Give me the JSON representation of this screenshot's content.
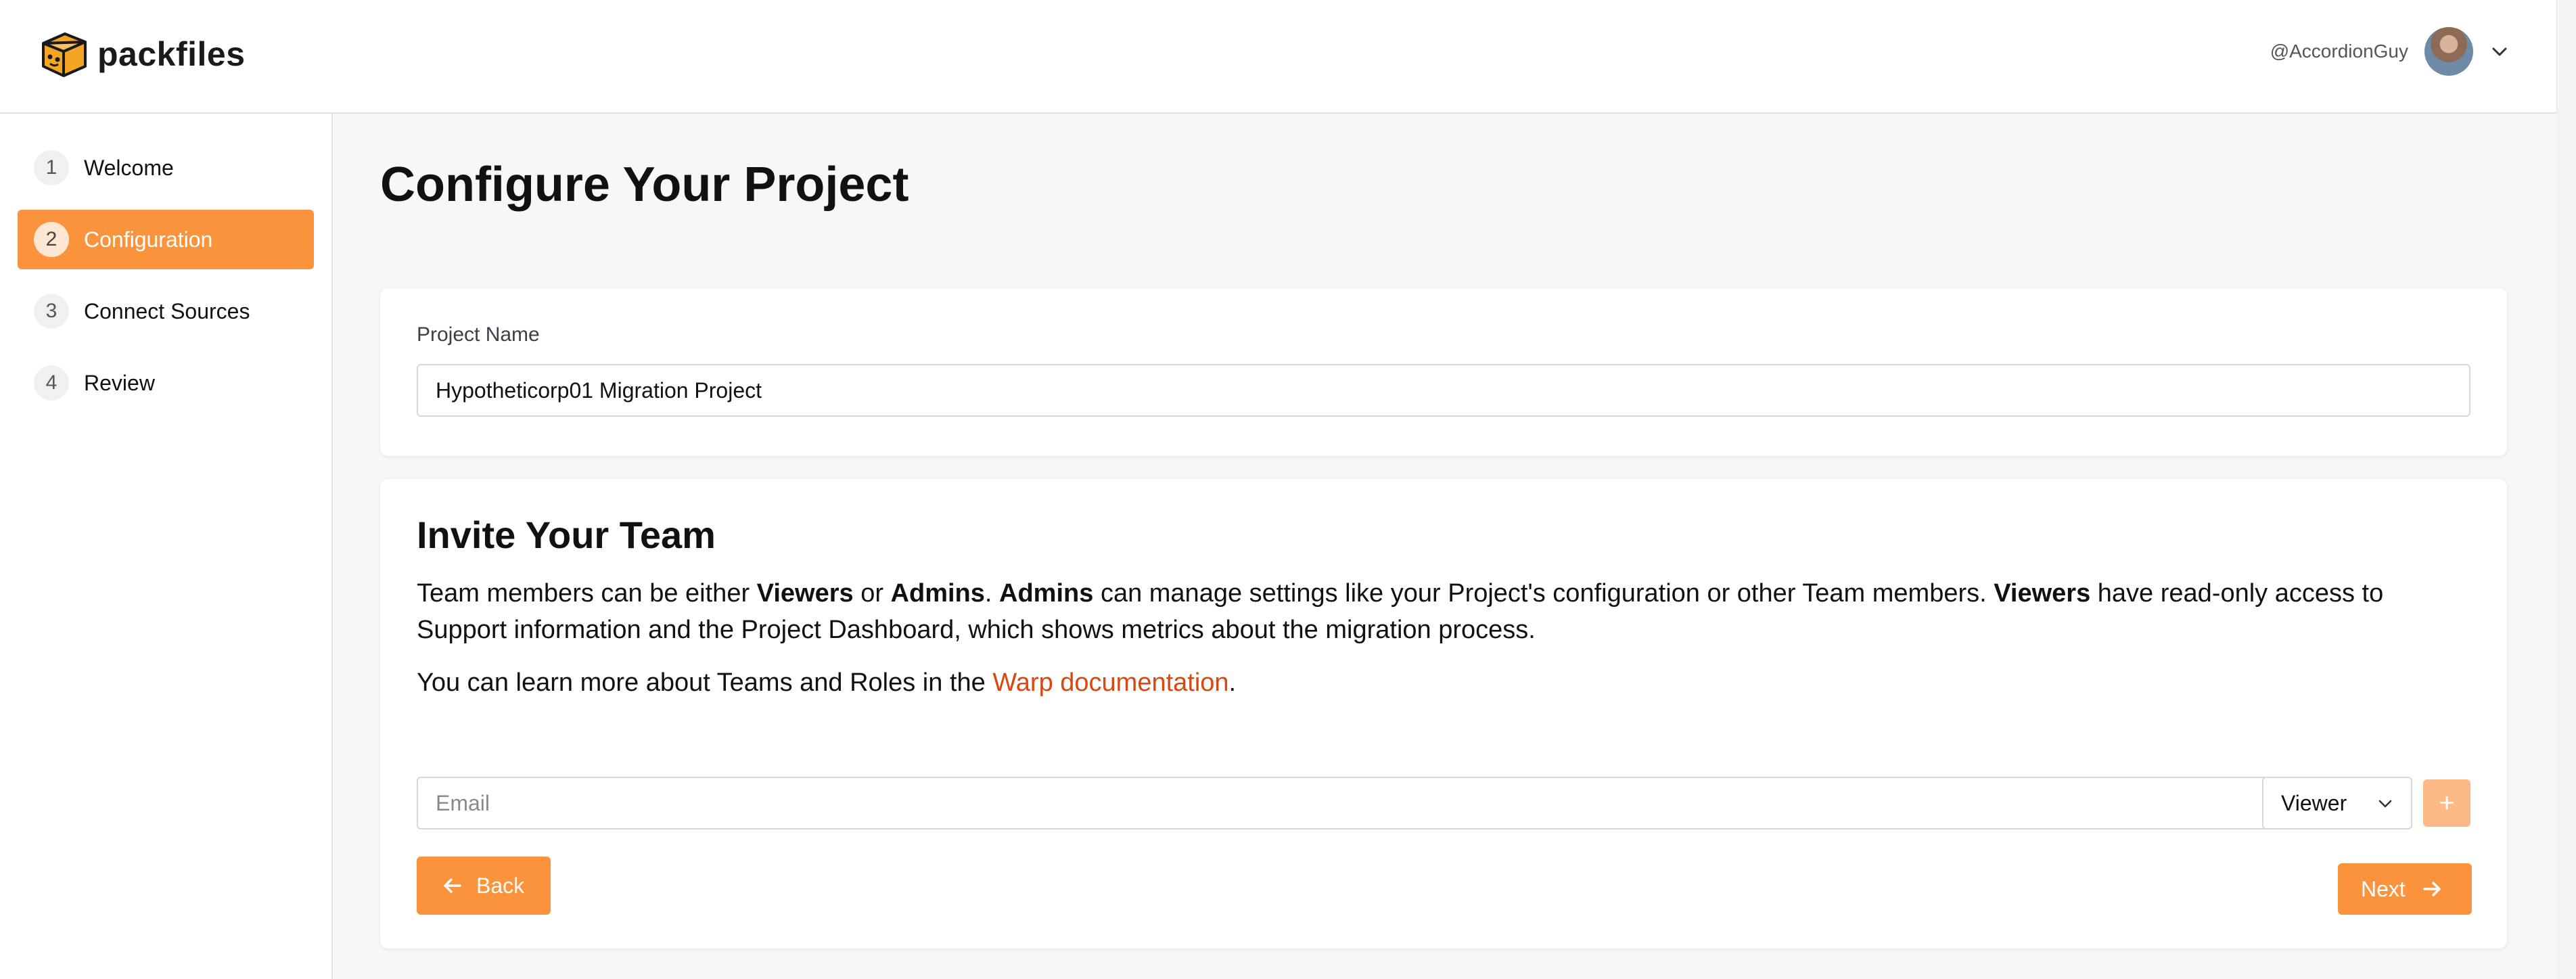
{
  "header": {
    "brand": "packfiles",
    "user_handle": "@AccordionGuy",
    "accent_color": "#fb923c"
  },
  "sidebar": {
    "items": [
      {
        "number": "1",
        "label": "Welcome",
        "active": false
      },
      {
        "number": "2",
        "label": "Configuration",
        "active": true
      },
      {
        "number": "3",
        "label": "Connect Sources",
        "active": false
      },
      {
        "number": "4",
        "label": "Review",
        "active": false
      }
    ]
  },
  "main": {
    "title": "Configure Your Project",
    "project": {
      "label": "Project Name",
      "value": "Hypotheticorp01 Migration Project"
    },
    "team": {
      "title": "Invite Your Team",
      "p1_a": "Team members can be either ",
      "p1_viewers": "Viewers",
      "p1_b": " or ",
      "p1_admins": "Admins",
      "p1_c": ". ",
      "p1_admins2": "Admins",
      "p1_d": " can manage settings like your Project's configuration or other Team members. ",
      "p1_viewers2": "Viewers",
      "p1_e": " have read-only access to Support information and the Project Dashboard, which shows metrics about the migration process.",
      "p2_a": "You can learn more about Teams and Roles in the ",
      "p2_link": "Warp documentation",
      "p2_b": ".",
      "email_placeholder": "Email",
      "role_value": "Viewer",
      "add_label": "+"
    },
    "back_label": "Back",
    "next_label": "Next"
  }
}
